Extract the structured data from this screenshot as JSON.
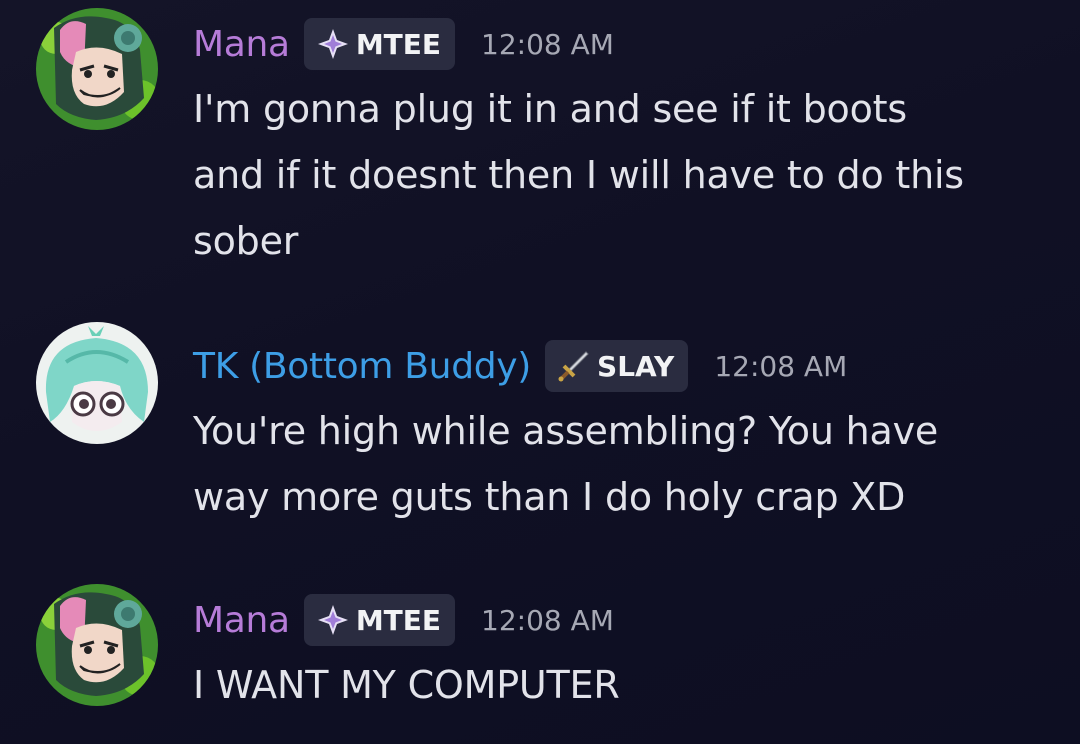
{
  "messages": [
    {
      "username": "Mana",
      "username_color": "#b67cd8",
      "tag": {
        "icon": "sparkle-icon",
        "label": "MTEE"
      },
      "timestamp": "12:08 AM",
      "lines": [
        "I'm gonna plug it in and see if it boots",
        "and if it doesnt then I will have to do this",
        "sober"
      ]
    },
    {
      "username": "TK (Bottom Buddy)",
      "username_color": "#3d9ee6",
      "tag": {
        "icon": "sword-icon",
        "label": "SLAY"
      },
      "timestamp": "12:08 AM",
      "lines": [
        "You're high while assembling? You have",
        "way more guts than I do holy crap XD"
      ]
    },
    {
      "username": "Mana",
      "username_color": "#b67cd8",
      "tag": {
        "icon": "sparkle-icon",
        "label": "MTEE"
      },
      "timestamp": "12:08 AM",
      "lines": [
        "I WANT MY COMPUTER"
      ]
    }
  ]
}
